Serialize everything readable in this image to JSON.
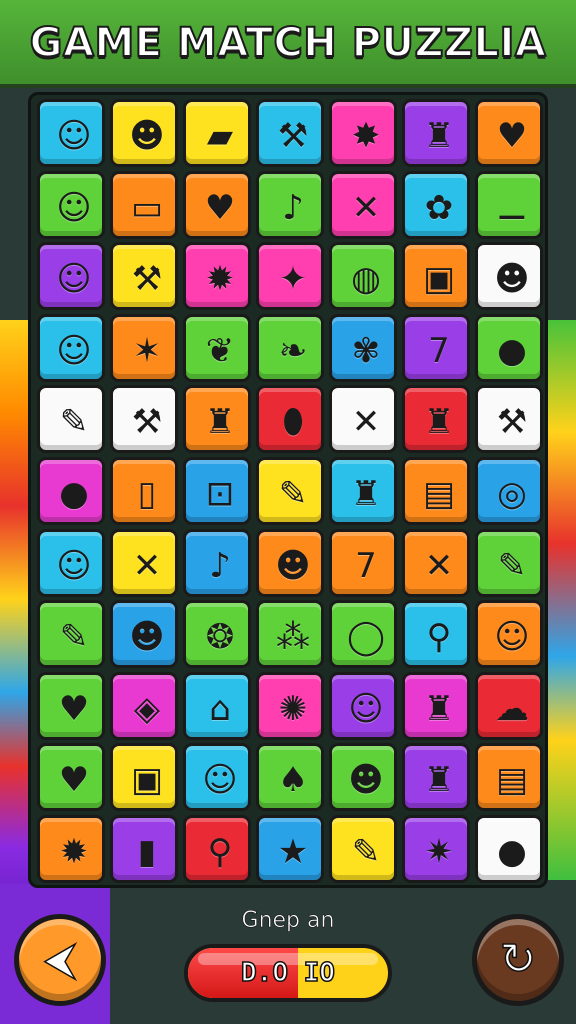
{
  "title": "GAME MATCH PUZZLIA",
  "status_label": "Gnep an",
  "meter": {
    "text": "D.O IO",
    "fill_fraction": 0.55
  },
  "buttons": {
    "back_icon": "back-arrow-icon",
    "restart_icon": "restart-icon"
  },
  "board": {
    "rows": [
      [
        {
          "color": "cyan",
          "icon": "apple-face-icon",
          "glyph": "☺"
        },
        {
          "color": "yellow",
          "icon": "pickle-face-icon",
          "glyph": "☻"
        },
        {
          "color": "yellow",
          "icon": "sandwich-icon",
          "glyph": "▰"
        },
        {
          "color": "cyan",
          "icon": "wrench-icon",
          "glyph": "⚒"
        },
        {
          "color": "pink",
          "icon": "star-icon",
          "glyph": "✸"
        },
        {
          "color": "purple",
          "icon": "trash-can-icon",
          "glyph": "♜"
        },
        {
          "color": "orange",
          "icon": "apple-icon",
          "glyph": "♥"
        }
      ],
      [
        {
          "color": "green",
          "icon": "green-blob-face-icon",
          "glyph": "☺"
        },
        {
          "color": "orange",
          "icon": "battery-icon",
          "glyph": "▭"
        },
        {
          "color": "orange",
          "icon": "strawberry-icon",
          "glyph": "♥"
        },
        {
          "color": "green",
          "icon": "maraca-icon",
          "glyph": "♪"
        },
        {
          "color": "pink",
          "icon": "crossed-sticks-icon",
          "glyph": "✕"
        },
        {
          "color": "cyan",
          "icon": "cotton-candy-icon",
          "glyph": "✿"
        },
        {
          "color": "green",
          "icon": "bone-icon",
          "glyph": "⚊"
        }
      ],
      [
        {
          "color": "purple",
          "icon": "blue-blob-face-icon",
          "glyph": "☺"
        },
        {
          "color": "yellow",
          "icon": "hammer-icon",
          "glyph": "⚒"
        },
        {
          "color": "pink",
          "icon": "starburst-icon",
          "glyph": "✹"
        },
        {
          "color": "pink",
          "icon": "silver-star-icon",
          "glyph": "✦"
        },
        {
          "color": "green",
          "icon": "football-icon",
          "glyph": "◍"
        },
        {
          "color": "orange",
          "icon": "radio-icon",
          "glyph": "▣"
        },
        {
          "color": "white",
          "icon": "pumpkin-face-icon",
          "glyph": "☻"
        }
      ],
      [
        {
          "color": "cyan",
          "icon": "orange-face-icon",
          "glyph": "☺"
        },
        {
          "color": "orange",
          "icon": "white-star-icon",
          "glyph": "✶"
        },
        {
          "color": "green",
          "icon": "carrot-icon",
          "glyph": "❦"
        },
        {
          "color": "green",
          "icon": "peanut-icon",
          "glyph": "❧"
        },
        {
          "color": "blue",
          "icon": "palm-leaf-icon",
          "glyph": "✾"
        },
        {
          "color": "purple",
          "icon": "number-seven-icon",
          "glyph": "7"
        },
        {
          "color": "green",
          "icon": "tomato-icon",
          "glyph": "●"
        }
      ],
      [
        {
          "color": "white",
          "icon": "firecracker-icon",
          "glyph": "✎"
        },
        {
          "color": "white",
          "icon": "trowel-icon",
          "glyph": "⚒"
        },
        {
          "color": "orange",
          "icon": "bucket-icon",
          "glyph": "♜"
        },
        {
          "color": "red",
          "icon": "blue-pill-icon",
          "glyph": "⬮"
        },
        {
          "color": "white",
          "icon": "crossed-bones-icon",
          "glyph": "✕"
        },
        {
          "color": "red",
          "icon": "green-bag-icon",
          "glyph": "♜"
        },
        {
          "color": "white",
          "icon": "blue-hammer-icon",
          "glyph": "⚒"
        }
      ],
      [
        {
          "color": "magenta",
          "icon": "chick-icon",
          "glyph": "●"
        },
        {
          "color": "orange",
          "icon": "phone-icon",
          "glyph": "▯"
        },
        {
          "color": "blue",
          "icon": "padlock-icon",
          "glyph": "⊡"
        },
        {
          "color": "yellow",
          "icon": "crayon-icon",
          "glyph": "✎"
        },
        {
          "color": "cyan",
          "icon": "lantern-icon",
          "glyph": "♜"
        },
        {
          "color": "orange",
          "icon": "jar-icon",
          "glyph": "▤"
        },
        {
          "color": "blue",
          "icon": "target-icon",
          "glyph": "◎"
        }
      ],
      [
        {
          "color": "cyan",
          "icon": "lemon-face-icon",
          "glyph": "☺"
        },
        {
          "color": "yellow",
          "icon": "crossed-sticks-icon",
          "glyph": "✕"
        },
        {
          "color": "blue",
          "icon": "green-maraca-icon",
          "glyph": "♪"
        },
        {
          "color": "orange",
          "icon": "orange-face-icon",
          "glyph": "☻"
        },
        {
          "color": "orange",
          "icon": "number-seven-icon",
          "glyph": "7"
        },
        {
          "color": "orange",
          "icon": "crossed-tools-icon",
          "glyph": "✕"
        },
        {
          "color": "green",
          "icon": "marker-icon",
          "glyph": "✎"
        }
      ],
      [
        {
          "color": "green",
          "icon": "pencil-eraser-icon",
          "glyph": "✎"
        },
        {
          "color": "blue",
          "icon": "purple-monster-icon",
          "glyph": "☻"
        },
        {
          "color": "green",
          "icon": "melon-icon",
          "glyph": "❂"
        },
        {
          "color": "green",
          "icon": "grapes-icon",
          "glyph": "⁂"
        },
        {
          "color": "green",
          "icon": "ring-icon",
          "glyph": "◯"
        },
        {
          "color": "cyan",
          "icon": "magnifier-icon",
          "glyph": "⚲"
        },
        {
          "color": "orange",
          "icon": "blue-blob-icon",
          "glyph": "☺"
        }
      ],
      [
        {
          "color": "green",
          "icon": "red-heart-icon",
          "glyph": "♥"
        },
        {
          "color": "magenta",
          "icon": "red-gem-icon",
          "glyph": "◈"
        },
        {
          "color": "cyan",
          "icon": "green-tag-icon",
          "glyph": "⌂"
        },
        {
          "color": "pink",
          "icon": "sunburst-icon",
          "glyph": "✺"
        },
        {
          "color": "purple",
          "icon": "pink-face-icon",
          "glyph": "☺"
        },
        {
          "color": "magenta",
          "icon": "green-trash-can-icon",
          "glyph": "♜"
        },
        {
          "color": "red",
          "icon": "cloud-icon",
          "glyph": "☁"
        }
      ],
      [
        {
          "color": "green",
          "icon": "pink-heart-icon",
          "glyph": "♥"
        },
        {
          "color": "yellow",
          "icon": "picture-frame-icon",
          "glyph": "▣"
        },
        {
          "color": "cyan",
          "icon": "lemon-face-icon",
          "glyph": "☺"
        },
        {
          "color": "green",
          "icon": "blue-drop-icon",
          "glyph": "♠"
        },
        {
          "color": "green",
          "icon": "cyan-blob-face-icon",
          "glyph": "☻"
        },
        {
          "color": "purple",
          "icon": "honey-pot-icon",
          "glyph": "♜"
        },
        {
          "color": "orange",
          "icon": "scroll-icon",
          "glyph": "▤"
        }
      ],
      [
        {
          "color": "orange",
          "icon": "gear-icon",
          "glyph": "✹"
        },
        {
          "color": "purple",
          "icon": "usb-stick-icon",
          "glyph": "▮"
        },
        {
          "color": "red",
          "icon": "microphone-icon",
          "glyph": "⚲"
        },
        {
          "color": "blue",
          "icon": "orange-star-icon",
          "glyph": "★"
        },
        {
          "color": "yellow",
          "icon": "paintbrush-icon",
          "glyph": "✎"
        },
        {
          "color": "purple",
          "icon": "blue-spark-icon",
          "glyph": "✷"
        },
        {
          "color": "white",
          "icon": "plum-icon",
          "glyph": "●"
        }
      ]
    ]
  }
}
